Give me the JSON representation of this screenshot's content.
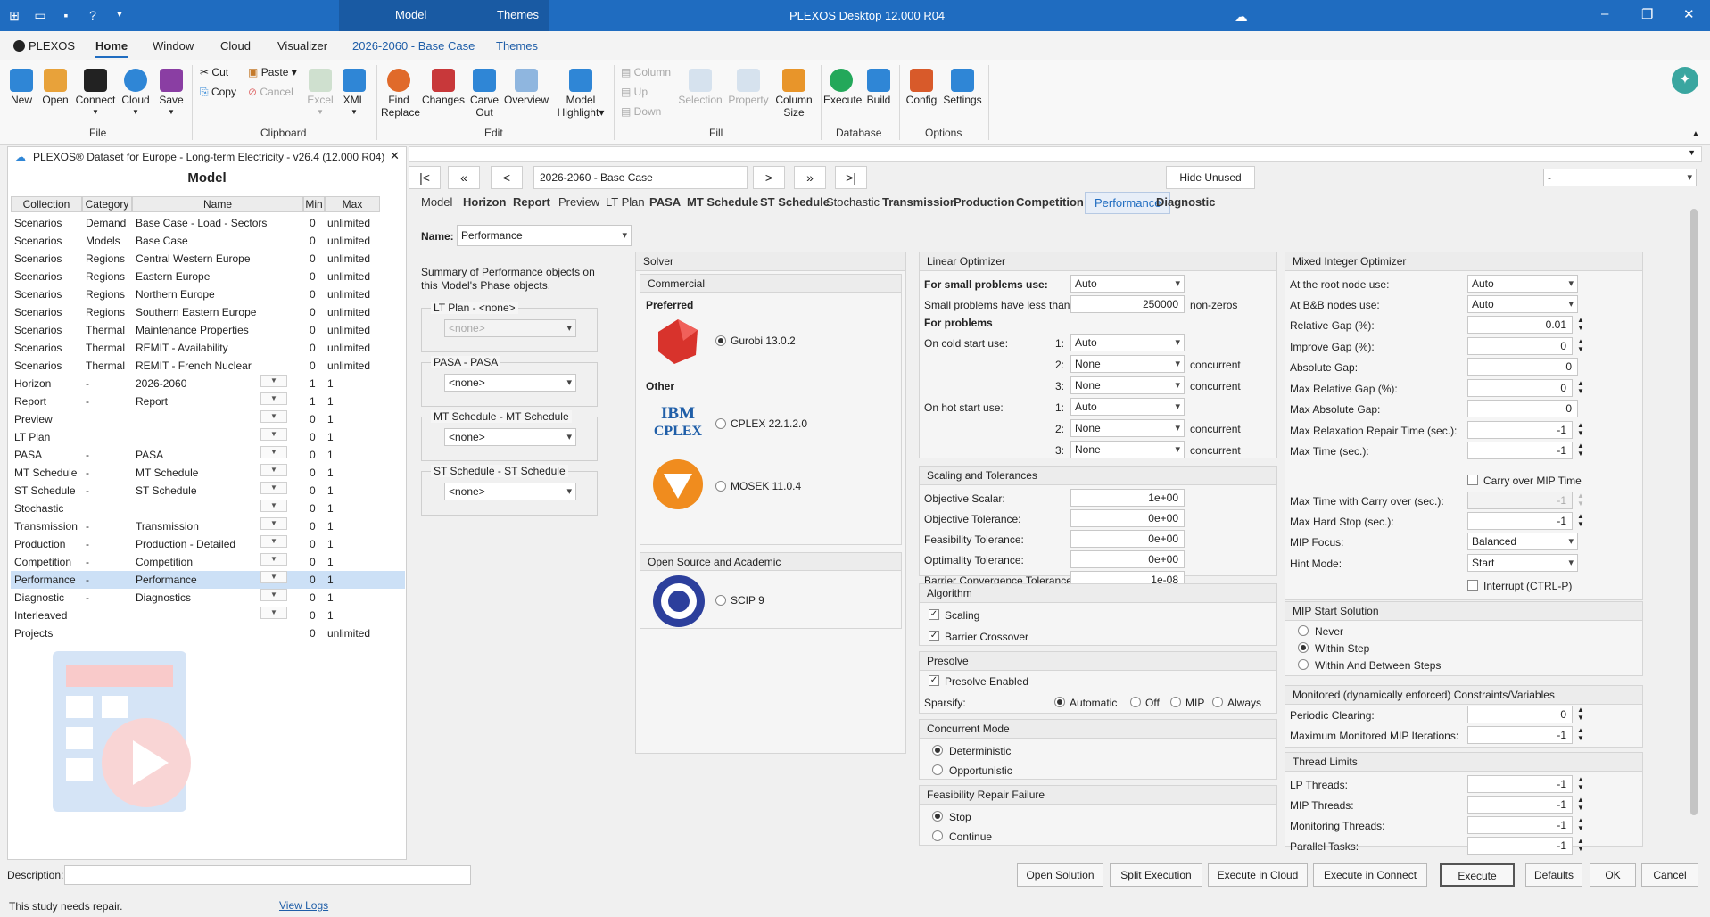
{
  "titlebar": {
    "title": "PLEXOS Desktop 12.000 R04",
    "context_tabs": [
      "Model",
      "Themes"
    ]
  },
  "menubar": {
    "items": [
      "PLEXOS",
      "Home",
      "Window",
      "Cloud",
      "Visualizer",
      "2026-2060 - Base Case",
      "Themes"
    ]
  },
  "ribbon": {
    "file": {
      "label": "File",
      "new": "New",
      "open": "Open",
      "connect": "Connect",
      "cloud": "Cloud",
      "save": "Save"
    },
    "clipboard": {
      "label": "Clipboard",
      "cut": "Cut",
      "copy": "Copy",
      "paste": "Paste",
      "cancel": "Cancel",
      "excel": "Excel",
      "xml": "XML"
    },
    "edit": {
      "label": "Edit",
      "find": "Find",
      "replace": "Replace",
      "changes": "Changes",
      "carve": "Carve",
      "out": "Out",
      "overview": "Overview",
      "model": "Model",
      "highlight": "Highlight"
    },
    "fill": {
      "label": "Fill",
      "column": "Column",
      "up": "Up",
      "down": "Down",
      "selection": "Selection",
      "property": "Property",
      "column2": "Column",
      "size": "Size"
    },
    "database": {
      "label": "Database",
      "execute": "Execute",
      "build": "Build"
    },
    "options": {
      "label": "Options",
      "config": "Config",
      "settings": "Settings"
    }
  },
  "left": {
    "header": "PLEXOS® Dataset for Europe - Long-term Electricity - v26.4 (12.000 R04)",
    "title": "Model",
    "columns": [
      "Collection",
      "Category",
      "Name",
      "Min",
      "Max"
    ],
    "rows": [
      {
        "collection": "Scenarios",
        "category": "Demand",
        "name": "Base Case - Load - Sectors",
        "min": "0",
        "max": "unlimited"
      },
      {
        "collection": "Scenarios",
        "category": "Models",
        "name": "Base Case",
        "min": "0",
        "max": "unlimited"
      },
      {
        "collection": "Scenarios",
        "category": "Regions",
        "name": "Central Western Europe",
        "min": "0",
        "max": "unlimited"
      },
      {
        "collection": "Scenarios",
        "category": "Regions",
        "name": "Eastern Europe",
        "min": "0",
        "max": "unlimited"
      },
      {
        "collection": "Scenarios",
        "category": "Regions",
        "name": "Northern Europe",
        "min": "0",
        "max": "unlimited"
      },
      {
        "collection": "Scenarios",
        "category": "Regions",
        "name": "Southern Eastern Europe",
        "min": "0",
        "max": "unlimited"
      },
      {
        "collection": "Scenarios",
        "category": "Thermal",
        "name": "Maintenance Properties",
        "min": "0",
        "max": "unlimited"
      },
      {
        "collection": "Scenarios",
        "category": "Thermal",
        "name": "REMIT - Availability",
        "min": "0",
        "max": "unlimited"
      },
      {
        "collection": "Scenarios",
        "category": "Thermal",
        "name": "REMIT - French Nuclear",
        "min": "0",
        "max": "unlimited"
      },
      {
        "collection": "Horizon",
        "category": "-",
        "name": "2026-2060",
        "min": "1",
        "max": "1"
      },
      {
        "collection": "Report",
        "category": "-",
        "name": "Report",
        "min": "1",
        "max": "1"
      },
      {
        "collection": "Preview",
        "category": "",
        "name": "",
        "min": "0",
        "max": "1"
      },
      {
        "collection": "LT Plan",
        "category": "",
        "name": "",
        "min": "0",
        "max": "1"
      },
      {
        "collection": "PASA",
        "category": "-",
        "name": "PASA",
        "min": "0",
        "max": "1"
      },
      {
        "collection": "MT Schedule",
        "category": "-",
        "name": "MT Schedule",
        "min": "0",
        "max": "1"
      },
      {
        "collection": "ST Schedule",
        "category": "-",
        "name": "ST Schedule",
        "min": "0",
        "max": "1"
      },
      {
        "collection": "Stochastic",
        "category": "",
        "name": "",
        "min": "0",
        "max": "1"
      },
      {
        "collection": "Transmission",
        "category": "-",
        "name": "Transmission",
        "min": "0",
        "max": "1"
      },
      {
        "collection": "Production",
        "category": "-",
        "name": "Production - Detailed",
        "min": "0",
        "max": "1"
      },
      {
        "collection": "Competition",
        "category": "-",
        "name": "Competition",
        "min": "0",
        "max": "1"
      },
      {
        "collection": "Performance",
        "category": "-",
        "name": "Performance",
        "min": "0",
        "max": "1"
      },
      {
        "collection": "Diagnostic",
        "category": "-",
        "name": "Diagnostics",
        "min": "0",
        "max": "1"
      },
      {
        "collection": "Interleaved",
        "category": "",
        "name": "",
        "min": "0",
        "max": "1"
      },
      {
        "collection": "Projects",
        "category": "",
        "name": "",
        "min": "0",
        "max": "unlimited"
      }
    ],
    "description_label": "Description:",
    "status": "This study needs repair.",
    "view_logs": "View Logs"
  },
  "nav": {
    "current": "2026-2060 - Base Case",
    "hide_unused": "Hide Unused",
    "right_select": "-"
  },
  "tabs": [
    "Model",
    "Horizon",
    "Report",
    "Preview",
    "LT Plan",
    "PASA",
    "MT Schedule",
    "ST Schedule",
    "Stochastic",
    "Transmission",
    "Production",
    "Competition",
    "Performance",
    "Diagnostic"
  ],
  "form": {
    "name_label": "Name:",
    "name_value": "Performance",
    "summary": [
      "Summary of Performance objects on",
      "this Model's Phase objects."
    ],
    "groups": [
      {
        "title": "LT Plan - <none>",
        "value": "<none>"
      },
      {
        "title": "PASA - PASA",
        "value": "<none>"
      },
      {
        "title": "MT Schedule - MT Schedule",
        "value": "<none>"
      },
      {
        "title": "ST Schedule - ST Schedule",
        "value": "<none>"
      }
    ]
  },
  "solver": {
    "title": "Solver",
    "commercial": "Commercial",
    "preferred": "Preferred",
    "other": "Other",
    "open_source": "Open Source and Academic",
    "gurobi": "Gurobi 13.0.2",
    "cplex": "CPLEX 22.1.2.0",
    "mosek": "MOSEK 11.0.4",
    "scip": "SCIP 9",
    "ibm_logo": "IBM",
    "cplex_logo": "CPLEX"
  },
  "linear": {
    "title": "Linear Optimizer",
    "small_use_label": "For small problems use:",
    "small_use_value": "Auto",
    "small_less_label": "Small problems have less than:",
    "small_less_value": "250000",
    "small_less_unit": "non-zeros",
    "for_problems": "For problems",
    "cold_label": "On cold start use:",
    "hot_label": "On hot start use:",
    "idx": [
      "1:",
      "2:",
      "3:"
    ],
    "cold": [
      "Auto",
      "None",
      "None"
    ],
    "hot": [
      "Auto",
      "None",
      "None"
    ],
    "concurrent": "concurrent"
  },
  "scaling": {
    "title": "Scaling and Tolerances",
    "rows": [
      {
        "label": "Objective Scalar:",
        "value": "1e+00"
      },
      {
        "label": "Objective Tolerance:",
        "value": "0e+00"
      },
      {
        "label": "Feasibility Tolerance:",
        "value": "0e+00"
      },
      {
        "label": "Optimality Tolerance:",
        "value": "0e+00"
      },
      {
        "label": "Barrier Convergence Tolerance:",
        "value": "1e-08"
      }
    ]
  },
  "algorithm": {
    "title": "Algorithm",
    "scaling": "Scaling",
    "barrier": "Barrier Crossover"
  },
  "presolve": {
    "title": "Presolve",
    "enabled": "Presolve Enabled",
    "sparsify": "Sparsify:",
    "options": [
      "Automatic",
      "Off",
      "MIP",
      "Always"
    ]
  },
  "concurrent_mode": {
    "title": "Concurrent Mode",
    "options": [
      "Deterministic",
      "Opportunistic"
    ]
  },
  "feas_repair": {
    "title": "Feasibility Repair Failure",
    "options": [
      "Stop",
      "Continue"
    ]
  },
  "mip": {
    "title": "Mixed Integer Optimizer",
    "root_label": "At the root node use:",
    "root_value": "Auto",
    "bb_label": "At B&B nodes use:",
    "bb_value": "Auto",
    "rows": [
      {
        "label": "Relative Gap (%):",
        "value": "0.01"
      },
      {
        "label": "Improve Gap (%):",
        "value": "0"
      },
      {
        "label": "Absolute Gap:",
        "value": "0"
      },
      {
        "label": "Max Relative Gap (%):",
        "value": "0"
      },
      {
        "label": "Max Absolute Gap:",
        "value": "0"
      },
      {
        "label": "Max Relaxation Repair Time (sec.):",
        "value": "-1"
      },
      {
        "label": "Max Time (sec.):",
        "value": "-1"
      }
    ],
    "carry_over": "Carry over MIP Time",
    "carry_label": "Max Time with Carry over (sec.):",
    "carry_value": "-1",
    "hardstop_label": "Max Hard Stop (sec.):",
    "hardstop_value": "-1",
    "focus_label": "MIP Focus:",
    "focus_value": "Balanced",
    "hint_label": "Hint Mode:",
    "hint_value": "Start",
    "interrupt": "Interrupt (CTRL-P)"
  },
  "mip_start": {
    "title": "MIP Start Solution",
    "options": [
      "Never",
      "Within Step",
      "Within And Between Steps"
    ]
  },
  "monitored": {
    "title": "Monitored (dynamically enforced) Constraints/Variables",
    "rows": [
      {
        "label": "Periodic Clearing:",
        "value": "0"
      },
      {
        "label": "Maximum Monitored MIP Iterations:",
        "value": "-1"
      }
    ]
  },
  "threads": {
    "title": "Thread Limits",
    "rows": [
      {
        "label": "LP Threads:",
        "value": "-1"
      },
      {
        "label": "MIP Threads:",
        "value": "-1"
      },
      {
        "label": "Monitoring Threads:",
        "value": "-1"
      },
      {
        "label": "Parallel Tasks:",
        "value": "-1"
      }
    ]
  },
  "buttons": [
    "Open Solution",
    "Split Execution",
    "Execute in Cloud",
    "Execute in Connect",
    "Execute",
    "Defaults",
    "OK",
    "Cancel"
  ],
  "colors": {
    "accent": "#1f6cc0",
    "selection": "#cce0f6"
  }
}
